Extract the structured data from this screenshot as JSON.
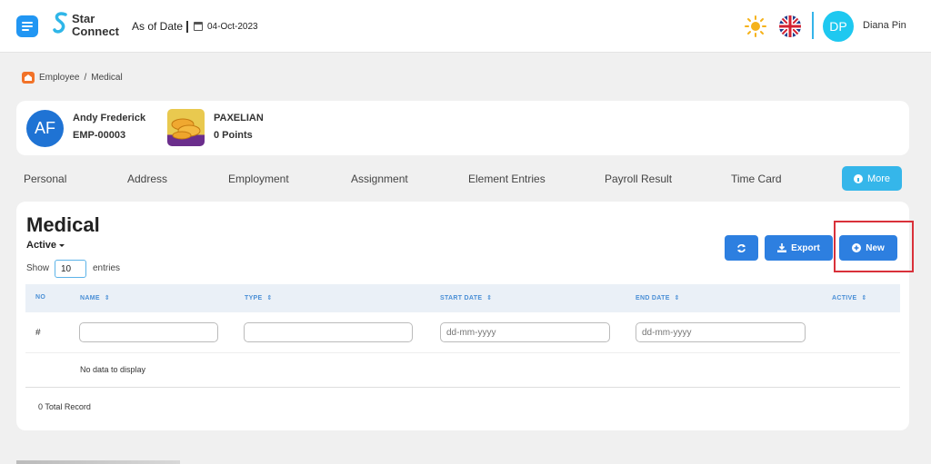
{
  "header": {
    "logo_line1": "Star",
    "logo_line2": "Connect",
    "as_of_label": "As of Date",
    "date": "04-Oct-2023",
    "user_initials": "DP",
    "user_name": "Diana Pin"
  },
  "breadcrumb": {
    "items": [
      "Employee",
      "/",
      "Medical"
    ]
  },
  "employee": {
    "initials": "AF",
    "name": "Andy Frederick",
    "id": "EMP-00003",
    "badge_name": "PAXELIAN",
    "points": "0 Points"
  },
  "tabs": [
    "Personal",
    "Address",
    "Employment",
    "Assignment",
    "Element Entries",
    "Payroll Result",
    "Time Card"
  ],
  "more_label": "More",
  "main": {
    "title": "Medical",
    "status": "Active",
    "show_label": "Show",
    "entries_value": "10",
    "entries_label": "entries",
    "export_label": "Export",
    "new_label": "New"
  },
  "table": {
    "columns": [
      "NO",
      "NAME",
      "TYPE",
      "START DATE",
      "END DATE",
      "ACTIVE"
    ],
    "row_marker": "#",
    "date_placeholder": "dd-mm-yyyy",
    "empty_text": "No data to display",
    "total": "0 Total Record"
  },
  "colors": {
    "primary": "#2d7fe0",
    "accent": "#35b6ea",
    "highlight": "#d9313a",
    "home_icon": "#f27329"
  }
}
